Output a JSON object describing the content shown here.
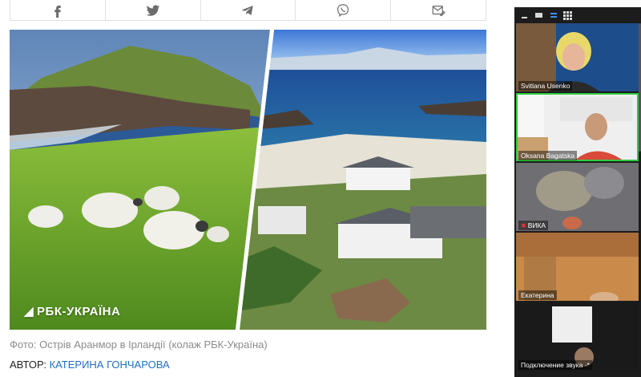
{
  "share_bar": {
    "buttons": [
      {
        "name": "facebook",
        "icon": "facebook-icon"
      },
      {
        "name": "twitter",
        "icon": "twitter-icon"
      },
      {
        "name": "telegram",
        "icon": "telegram-icon"
      },
      {
        "name": "viber",
        "icon": "viber-icon"
      },
      {
        "name": "email",
        "icon": "email-icon"
      }
    ]
  },
  "photo": {
    "watermark": "РБК-УКРАЇНА"
  },
  "caption": "Фото: Острів Аранмор в Ірландії (колаж РБК-Україна)",
  "author": {
    "label": "АВТОР: ",
    "name": "КАТЕРИНА ГОНЧАРОВА"
  },
  "zoom": {
    "toolbar": [
      "minimize-icon",
      "window-icon",
      "speaker-view-icon",
      "gallery-view-icon"
    ],
    "participants": [
      {
        "name": "Svitlana Usenko",
        "muted": false
      },
      {
        "name": "Oksana Bagatska",
        "muted": false
      },
      {
        "name": "ВИКА",
        "muted": true
      },
      {
        "name": "Екатерина",
        "muted": false
      },
      {
        "name": "Подключение звука ·*",
        "muted": false
      }
    ],
    "active_color": "#2ecc40"
  }
}
